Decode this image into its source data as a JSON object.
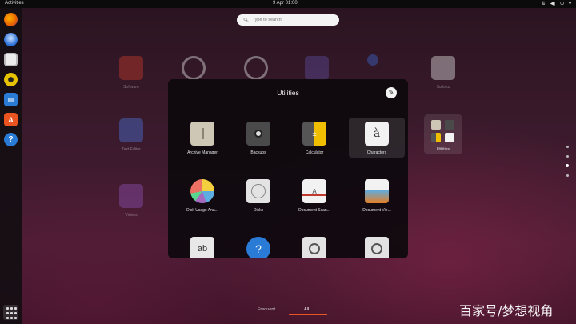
{
  "topbar": {
    "activities": "Activities",
    "clock": "9 Apr 01:00"
  },
  "search": {
    "placeholder": "Type to search"
  },
  "dock": {
    "items": [
      {
        "icon": "firefox-icon",
        "color": "#e66000"
      },
      {
        "icon": "thunderbird-icon",
        "color": "#2a6fd6"
      },
      {
        "icon": "files-icon",
        "color": "#e8e8e8"
      },
      {
        "icon": "rhythmbox-icon",
        "color": "#e6c200"
      },
      {
        "icon": "libreoffice-writer-icon",
        "color": "#2a7bd6"
      },
      {
        "icon": "ubuntu-software-icon",
        "color": "#e95420"
      },
      {
        "icon": "help-icon",
        "color": "#2a7bd6"
      }
    ]
  },
  "background_apps": [
    {
      "label": "Software",
      "color": "#c0392b"
    },
    {
      "label": "",
      "color": "#e0e0e0"
    },
    {
      "label": "",
      "color": "#e0e0e0"
    },
    {
      "label": "",
      "color": "#5b4b9a"
    },
    {
      "label": "",
      "color": "#3b63c7"
    },
    {
      "label": "Sudoku",
      "color": "#d9d9d9"
    },
    {
      "label": "Text Editor",
      "color": "#4a6fd0"
    },
    {
      "label": "Videos",
      "color": "#8a4fb0"
    }
  ],
  "folder": {
    "title": "Utilities",
    "apps": [
      {
        "label": "Archive Manager",
        "icon": "archive-manager-icon"
      },
      {
        "label": "Backups",
        "icon": "backups-icon"
      },
      {
        "label": "Calculator",
        "icon": "calculator-icon"
      },
      {
        "label": "Characters",
        "icon": "characters-icon",
        "selected": true
      },
      {
        "label": "Disk Usage Ana...",
        "icon": "disk-usage-icon"
      },
      {
        "label": "Disks",
        "icon": "disks-icon"
      },
      {
        "label": "Document Scan...",
        "icon": "document-scanner-icon"
      },
      {
        "label": "Document Vie...",
        "icon": "document-viewer-icon"
      },
      {
        "label": "",
        "icon": "fonts-icon"
      },
      {
        "label": "",
        "icon": "help-icon"
      },
      {
        "label": "",
        "icon": "magnifier-icon"
      },
      {
        "label": "",
        "icon": "search-icon"
      }
    ]
  },
  "folder_preview": {
    "label": "Utilities"
  },
  "tabs": {
    "frequent": "Frequent",
    "all": "All"
  },
  "watermark": "百家号/梦想视角",
  "colors": {
    "accent": "#e95420"
  }
}
